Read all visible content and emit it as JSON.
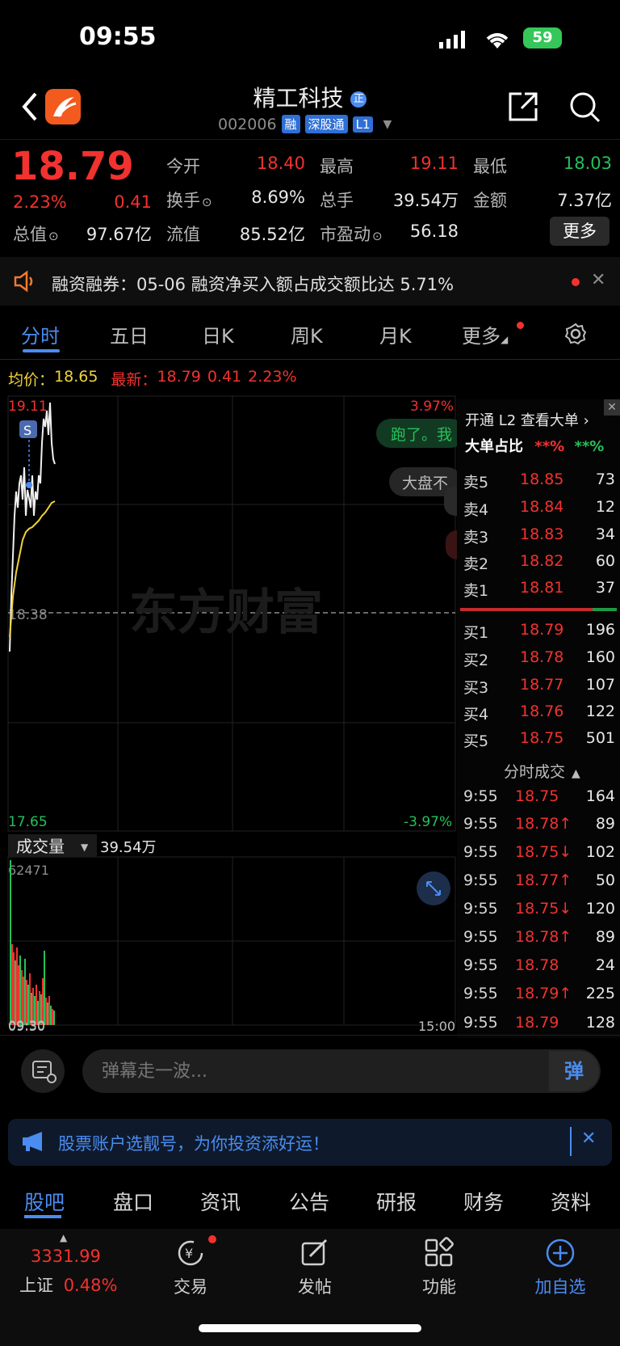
{
  "status": {
    "time": "09:55",
    "battery": "59"
  },
  "header": {
    "name": "精工科技",
    "name_badge": "正",
    "code": "002006",
    "tags": [
      "融",
      "深股通",
      "L1"
    ]
  },
  "quote": {
    "price": "18.79",
    "pct": "2.23%",
    "change": "0.41",
    "fields": [
      {
        "label": "今开",
        "value": "18.40",
        "color": "red"
      },
      {
        "label": "最高",
        "value": "19.11",
        "color": "red"
      },
      {
        "label": "最低",
        "value": "18.03",
        "color": "green"
      },
      {
        "label": "换手",
        "value": "8.69%",
        "color": "white"
      },
      {
        "label": "总手",
        "value": "39.54万",
        "color": "white"
      },
      {
        "label": "金额",
        "value": "7.37亿",
        "color": "white"
      },
      {
        "label": "总值",
        "value": "97.67亿",
        "color": "white"
      },
      {
        "label": "流值",
        "value": "85.52亿",
        "color": "white"
      },
      {
        "label": "市盈动",
        "value": "56.18",
        "color": "white"
      }
    ],
    "more_label": "更多"
  },
  "notice": {
    "text": "融资融券：05-06 融资净买入额占成交额比达 5.71%"
  },
  "tabs": [
    "分时",
    "五日",
    "日K",
    "周K",
    "月K",
    "更多"
  ],
  "avg": {
    "label": "均价：",
    "value": "18.65",
    "latest_label": "最新：",
    "latest": "18.79",
    "chg": "0.41",
    "pct": "2.23%"
  },
  "chart": {
    "high_label": "19.11",
    "low_label": "17.65",
    "base_label": "18.38",
    "high_pct": "3.97%",
    "low_pct": "-3.97%",
    "watermark": "东方财富",
    "bubbles": [
      "跑了。我",
      "大盘不"
    ],
    "signal": "S",
    "volume_label": "成交量",
    "volume_value": "39.54万",
    "volume_max": "62471",
    "time_start": "09:30",
    "time_end": "15:00"
  },
  "orderbook": {
    "upgrade": "开通 L2 查看大单",
    "big_ratio_label": "大单占比",
    "big_red": "**%",
    "big_green": "**%",
    "asks": [
      {
        "label": "卖5",
        "price": "18.85",
        "vol": "73"
      },
      {
        "label": "卖4",
        "price": "18.84",
        "vol": "12"
      },
      {
        "label": "卖3",
        "price": "18.83",
        "vol": "34"
      },
      {
        "label": "卖2",
        "price": "18.82",
        "vol": "60"
      },
      {
        "label": "卖1",
        "price": "18.81",
        "vol": "37"
      }
    ],
    "bids": [
      {
        "label": "买1",
        "price": "18.79",
        "vol": "196"
      },
      {
        "label": "买2",
        "price": "18.78",
        "vol": "160"
      },
      {
        "label": "买3",
        "price": "18.77",
        "vol": "107"
      },
      {
        "label": "买4",
        "price": "18.76",
        "vol": "122"
      },
      {
        "label": "买5",
        "price": "18.75",
        "vol": "501"
      }
    ],
    "ticks_title": "分时成交",
    "ticks": [
      {
        "time": "9:55",
        "price": "18.75",
        "vol": "164",
        "dir": "",
        "vcolor": "red"
      },
      {
        "time": "9:55",
        "price": "18.78↑",
        "vol": "89",
        "dir": "up",
        "vcolor": "red"
      },
      {
        "time": "9:55",
        "price": "18.75↓",
        "vol": "102",
        "dir": "down",
        "vcolor": "green"
      },
      {
        "time": "9:55",
        "price": "18.77↑",
        "vol": "50",
        "dir": "up",
        "vcolor": "red"
      },
      {
        "time": "9:55",
        "price": "18.75↓",
        "vol": "120",
        "dir": "down",
        "vcolor": "green"
      },
      {
        "time": "9:55",
        "price": "18.78↑",
        "vol": "89",
        "dir": "up",
        "vcolor": "red"
      },
      {
        "time": "9:55",
        "price": "18.78",
        "vol": "24",
        "dir": "",
        "vcolor": "green"
      },
      {
        "time": "9:55",
        "price": "18.79↑",
        "vol": "225",
        "dir": "up",
        "vcolor": "red"
      },
      {
        "time": "9:55",
        "price": "18.79",
        "vol": "128",
        "dir": "",
        "vcolor": "green"
      }
    ]
  },
  "comment": {
    "placeholder": "弹幕走一波...",
    "button": "弹"
  },
  "ad": {
    "text": "股票账户选靓号，为你投资添好运！"
  },
  "bottom_tabs": [
    "股吧",
    "盘口",
    "资讯",
    "公告",
    "研报",
    "财务",
    "资料"
  ],
  "nav": {
    "index_value": "3331.99",
    "index_name": "上证",
    "index_pct": "0.48%",
    "items": [
      "交易",
      "发帖",
      "功能",
      "加自选"
    ]
  }
}
